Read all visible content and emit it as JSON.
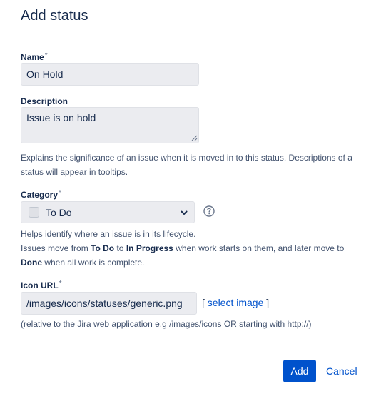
{
  "dialog": {
    "title": "Add status"
  },
  "name": {
    "label": "Name",
    "required_marker": "*",
    "value": "On Hold"
  },
  "description": {
    "label": "Description",
    "value": "Issue is on hold",
    "help": "Explains the significance of an issue when it is moved in to this status. Descriptions of a status will appear in tooltips."
  },
  "category": {
    "label": "Category",
    "required_marker": "*",
    "selected": "To Do",
    "swatch_color": "#dfe1e6",
    "help_icon": "question-circle-icon",
    "help_line1": "Helps identify where an issue is in its lifecycle.",
    "help_line2_prefix": "Issues move from ",
    "help_todo": "To Do",
    "help_to": " to ",
    "help_inprogress": "In Progress",
    "help_line2_mid": " when work starts on them, and later move to",
    "help_done": "Done",
    "help_line3_suffix": " when all work is complete."
  },
  "icon_url": {
    "label": "Icon URL",
    "required_marker": "*",
    "value": "/images/icons/statuses/generic.png",
    "select_open": "[ ",
    "select_link": "select image",
    "select_close": " ]",
    "help": "(relative to the Jira web application e.g /images/icons OR starting with http://)"
  },
  "actions": {
    "add_label": "Add",
    "cancel_label": "Cancel",
    "primary_color": "#0052cc"
  }
}
